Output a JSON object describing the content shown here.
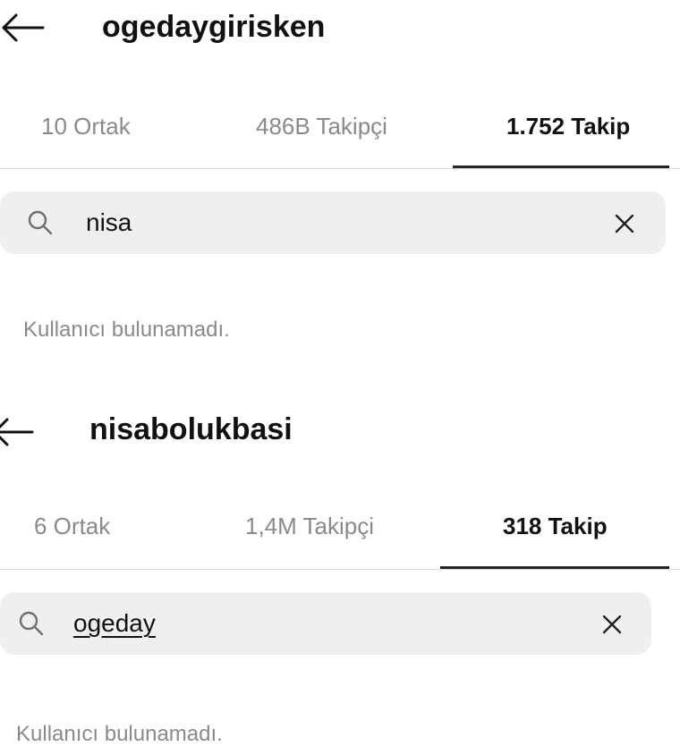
{
  "panels": [
    {
      "username": "ogedaygirisken",
      "tabs": [
        {
          "label": "10 Ortak",
          "active": false
        },
        {
          "label": "486B Takipçi",
          "active": false
        },
        {
          "label": "1.752 Takip",
          "active": true
        }
      ],
      "search": {
        "value": "nisa"
      },
      "empty_message": "Kullanıcı bulunamadı."
    },
    {
      "username": "nisabolukbasi",
      "tabs": [
        {
          "label": "6 Ortak",
          "active": false
        },
        {
          "label": "1,4M Takipçi",
          "active": false
        },
        {
          "label": "318 Takip",
          "active": true
        }
      ],
      "search": {
        "value": "ogeday"
      },
      "empty_message": "Kullanıcı bulunamadı."
    }
  ],
  "icons": {
    "back": "back-arrow-icon",
    "search": "search-icon",
    "clear": "close-icon"
  },
  "colors": {
    "active_tab_text": "#111111",
    "inactive_tab_text": "#8a8a8a",
    "search_background": "#efefef",
    "tab_underline": "#262626"
  }
}
